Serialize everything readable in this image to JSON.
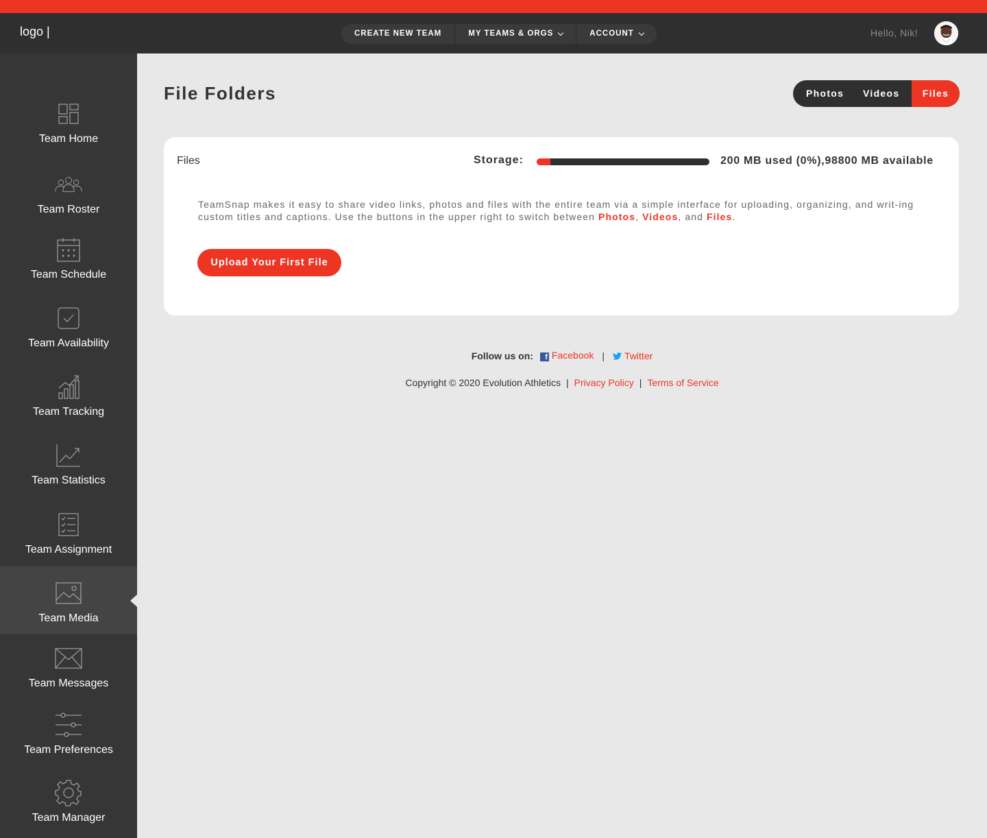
{
  "header": {
    "logo": "logo |",
    "nav": [
      {
        "label": "CREATE NEW TEAM",
        "has_dropdown": false
      },
      {
        "label": "MY TEAMS & ORGS",
        "has_dropdown": true
      },
      {
        "label": "ACCOUNT",
        "has_dropdown": true
      }
    ],
    "greeting": "Hello, Nik!"
  },
  "sidebar": {
    "items": [
      {
        "label": "Team Home",
        "icon": "dashboard-icon"
      },
      {
        "label": "Team Roster",
        "icon": "users-icon"
      },
      {
        "label": "Team Schedule",
        "icon": "calendar-icon"
      },
      {
        "label": "Team Availability",
        "icon": "checkbox-icon"
      },
      {
        "label": "Team Tracking",
        "icon": "bar-chart-icon"
      },
      {
        "label": "Team Statistics",
        "icon": "trend-chart-icon"
      },
      {
        "label": "Team Assignment",
        "icon": "checklist-icon"
      },
      {
        "label": "Team Media",
        "icon": "image-icon",
        "active": true
      },
      {
        "label": "Team Messages",
        "icon": "envelope-icon"
      },
      {
        "label": "Team Preferences",
        "icon": "sliders-icon"
      },
      {
        "label": "Team Manager",
        "icon": "gear-icon"
      }
    ]
  },
  "main": {
    "title": "File Folders",
    "tabs": [
      {
        "label": "Photos"
      },
      {
        "label": "Videos"
      },
      {
        "label": "Files",
        "active": true
      }
    ],
    "card": {
      "title": "Files",
      "storage_label": "Storage:",
      "storage_used_fraction": 0.08,
      "storage_text": "200 MB used (0%),98800 MB available",
      "description_prefix": "TeamSnap makes it easy to share video links, photos and files with the entire team via a simple interface for uploading, organizing, and writ-ing custom titles and captions. Use the buttons in the upper right to switch between ",
      "desc_link_photos": "Photos",
      "desc_comma": ", ",
      "desc_link_videos": "Videos",
      "desc_and": ", and ",
      "desc_link_files": "Files",
      "desc_end": ".",
      "upload_button": "Upload Your First File"
    }
  },
  "footer": {
    "follow_label": "Follow us on:",
    "facebook": "Facebook",
    "twitter": "Twitter",
    "separator": "|",
    "copyright": "Copyright © 2020 Evolution Athletics",
    "privacy": "Privacy Policy",
    "terms": "Terms of Service"
  },
  "colors": {
    "accent": "#ee3524",
    "dark": "#2f2f2f",
    "sidebar": "#363636",
    "background": "#e8e8e8"
  }
}
